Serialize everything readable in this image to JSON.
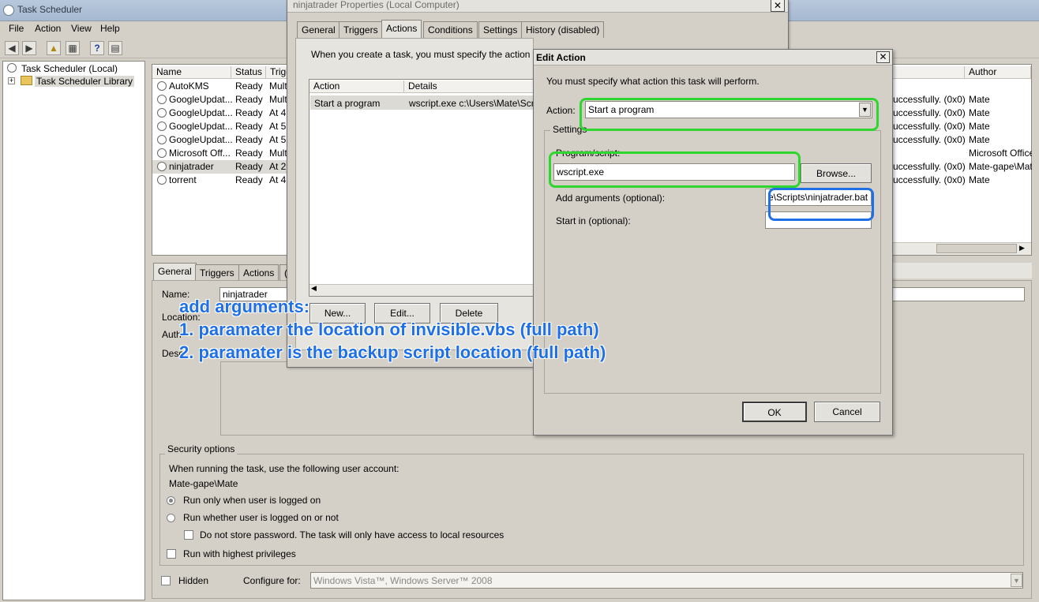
{
  "app": {
    "title": "Task Scheduler"
  },
  "menu": [
    "File",
    "Action",
    "View",
    "Help"
  ],
  "tree": {
    "root": "Task Scheduler (Local)",
    "library": "Task Scheduler Library"
  },
  "tasks": {
    "columns": [
      "Name",
      "Status",
      "Trigg"
    ],
    "rows": [
      {
        "name": "AutoKMS",
        "status": "Ready",
        "trigger": "Mult"
      },
      {
        "name": "GoogleUpdat...",
        "status": "Ready",
        "trigger": "Mult"
      },
      {
        "name": "GoogleUpdat...",
        "status": "Ready",
        "trigger": "At 4"
      },
      {
        "name": "GoogleUpdat...",
        "status": "Ready",
        "trigger": "At 5"
      },
      {
        "name": "GoogleUpdat...",
        "status": "Ready",
        "trigger": "At 5"
      },
      {
        "name": "Microsoft Off...",
        "status": "Ready",
        "trigger": "Mult"
      },
      {
        "name": "ninjatrader",
        "status": "Ready",
        "trigger": "At 2"
      },
      {
        "name": "torrent",
        "status": "Ready",
        "trigger": "At 4"
      }
    ],
    "right_header": "Author",
    "right_rows": [
      {
        "result": "uccessfully. (0x0)",
        "author": "Mate"
      },
      {
        "result": "uccessfully. (0x0)",
        "author": "Mate"
      },
      {
        "result": "uccessfully. (0x0)",
        "author": "Mate"
      },
      {
        "result": "uccessfully. (0x0)",
        "author": "Mate"
      },
      {
        "result": "",
        "author": "Microsoft Office"
      },
      {
        "result": "uccessfully. (0x0)",
        "author": "Mate-gape\\Mate"
      },
      {
        "result": "uccessfully. (0x0)",
        "author": "Mate"
      }
    ]
  },
  "details": {
    "tabs": [
      "General",
      "Triggers",
      "Actions",
      "("
    ],
    "name_label": "Name:",
    "name_value": "ninjatrader",
    "location_label": "Location:",
    "author_label": "Auth",
    "desc_label": "Desc",
    "security_title": "Security options",
    "account_prompt": "When running the task, use the following user account:",
    "account": "Mate-gape\\Mate",
    "radio1": "Run only when user is logged on",
    "radio2": "Run whether user is logged on or not",
    "no_store": "Do not store password.  The task will only have access to local resources",
    "highest": "Run with highest privileges",
    "hidden": "Hidden",
    "configure_label": "Configure for:",
    "configure_value": "Windows Vista™, Windows Server™ 2008"
  },
  "props": {
    "title": "ninjatrader Properties (Local Computer)",
    "tabs": [
      "General",
      "Triggers",
      "Actions",
      "Conditions",
      "Settings",
      "History (disabled)"
    ],
    "intro": "When you create a task, you must specify the action t",
    "col_action": "Action",
    "col_details": "Details",
    "row_action": "Start a program",
    "row_details": "wscript.exe c:\\Users\\Mate\\Scr",
    "btn_new": "New...",
    "btn_edit": "Edit...",
    "btn_delete": "Delete"
  },
  "edit": {
    "title": "Edit Action",
    "intro": "You must specify what action this task will perform.",
    "action_label": "Action:",
    "action_value": "Start a program",
    "settings_label": "Settings",
    "program_label": "Program/script:",
    "program_value": "wscript.exe",
    "browse": "Browse...",
    "args_label": "Add arguments (optional):",
    "args_value": "e\\Scripts\\ninjatrader.bat",
    "start_label": "Start in (optional):",
    "start_value": "",
    "ok": "OK",
    "cancel": "Cancel"
  },
  "annotation": {
    "line1": "add arguments:",
    "line2": "1. paramater the location of invisible.vbs (full path)",
    "line3": "2. paramater is the backup script location (full path)"
  },
  "colors": {
    "annotation": "#1f6fe6",
    "highlight_green": "#2fd62f"
  },
  "icons": [
    "task-scheduler-icon",
    "back-icon",
    "forward-icon",
    "up-folder-icon",
    "show-hide-icon",
    "help-icon",
    "properties-icon"
  ]
}
